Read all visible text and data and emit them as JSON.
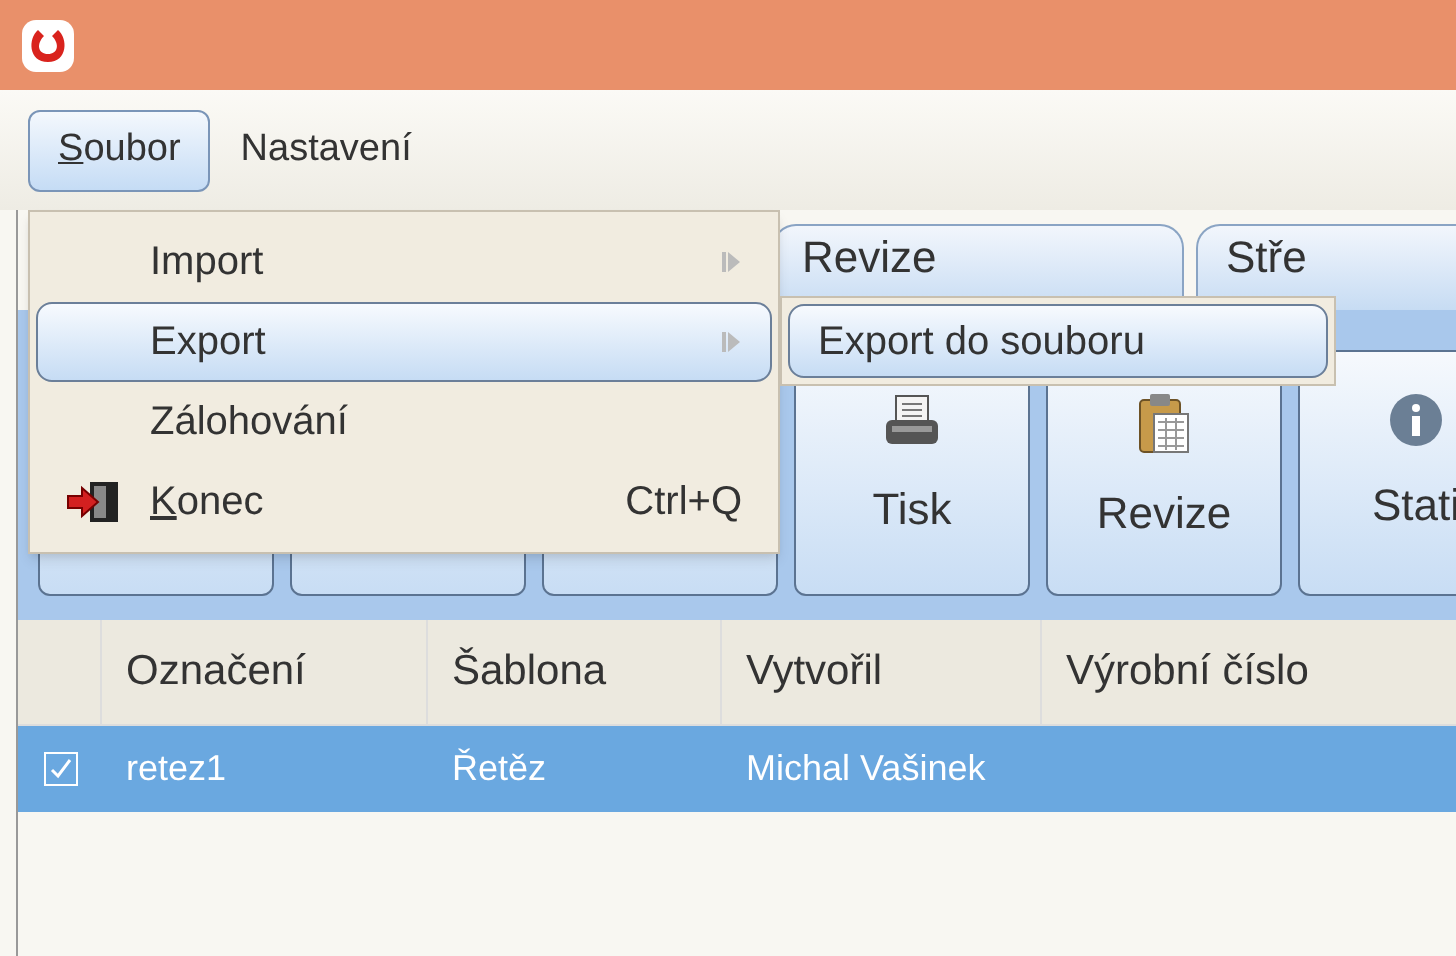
{
  "menubar": [
    {
      "label": "Soubor",
      "mnemonic_underlined": true,
      "selected": true
    },
    {
      "label": "Nastavení",
      "mnemonic_underlined": false,
      "selected": false
    }
  ],
  "menu": [
    {
      "label": "Import",
      "kind": "submenu",
      "mnemonic_underlined": false,
      "selected": false
    },
    {
      "label": "Export",
      "kind": "submenu",
      "mnemonic_underlined": false,
      "selected": true
    },
    {
      "label": "Zálohování",
      "kind": "plain",
      "mnemonic_underlined": false,
      "selected": false
    },
    {
      "label": "Konec",
      "kind": "exit",
      "mnemonic_underlined": true,
      "shortcut": "Ctrl+Q",
      "selected": false
    }
  ],
  "submenu": [
    {
      "label": "Export do souboru",
      "selected": true
    }
  ],
  "tabs": [
    {
      "label": "Revize",
      "selected": false
    },
    {
      "label": "Stře",
      "selected": false
    }
  ],
  "toolbar": [
    {
      "kind": "covered"
    },
    {
      "kind": "covered"
    },
    {
      "kind": "covered"
    },
    {
      "kind": "print",
      "label": "Tisk"
    },
    {
      "kind": "clipboard",
      "label": "Revize"
    },
    {
      "kind": "info",
      "label": "Stati"
    }
  ],
  "table": {
    "columns": [
      "Označení",
      "Šablona",
      "Vytvořil",
      "Výrobní číslo"
    ],
    "rows": [
      {
        "checked": true,
        "selected": true,
        "cells": [
          "retez1",
          "Řetěz",
          "Michal Vašinek"
        ]
      }
    ]
  }
}
